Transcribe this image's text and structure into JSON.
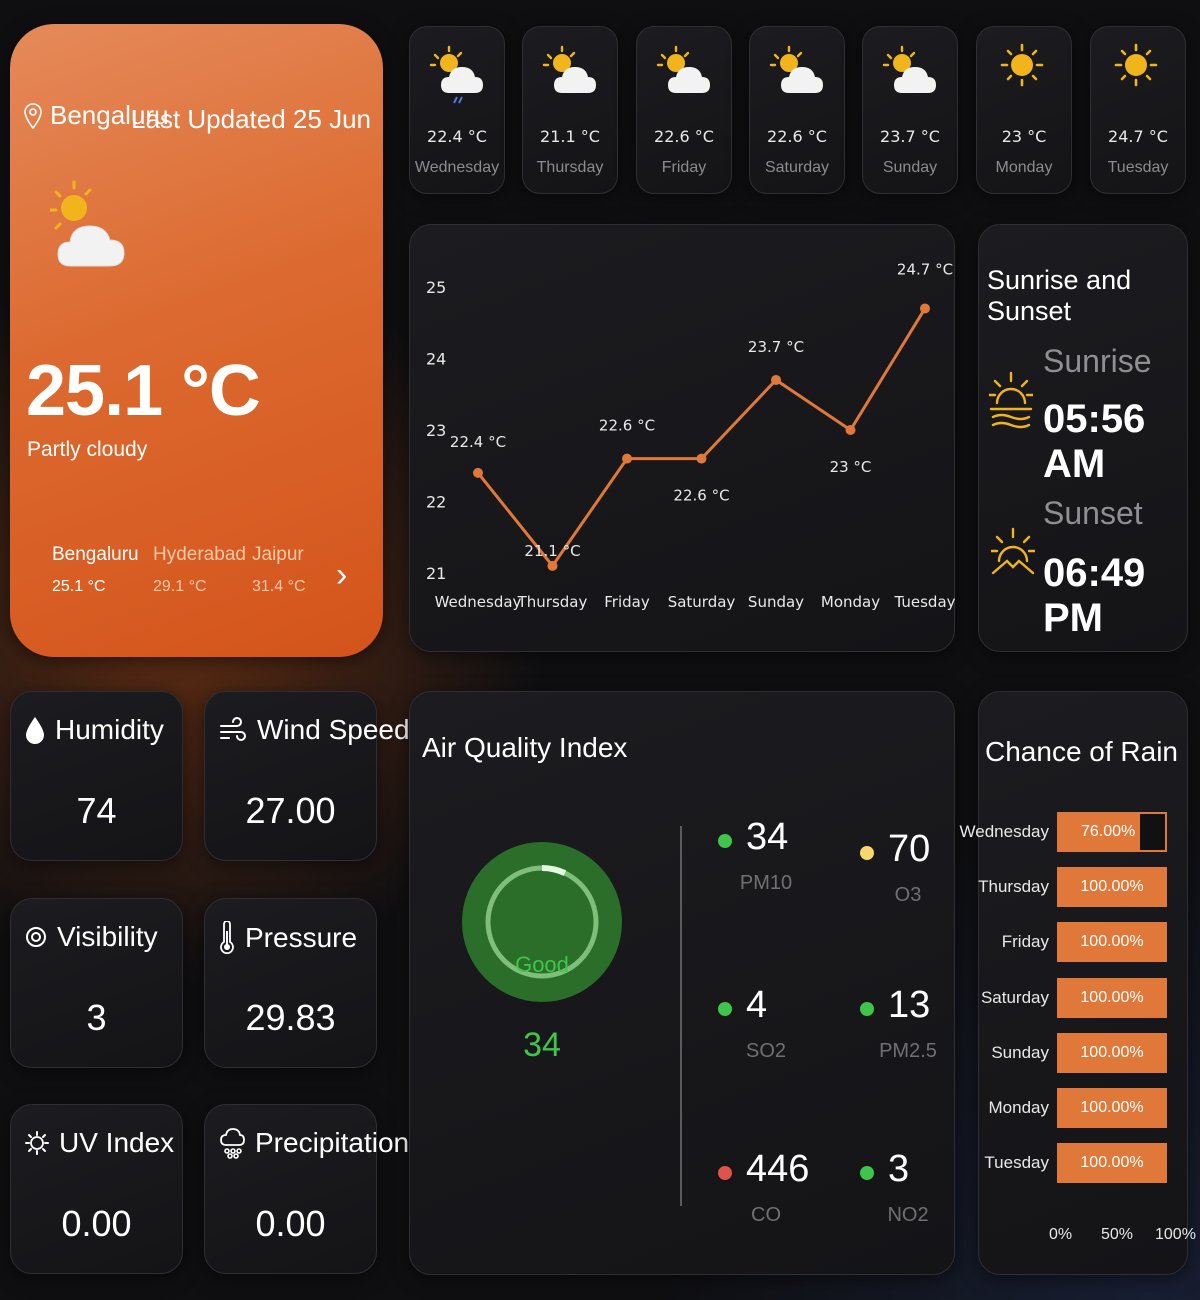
{
  "location": {
    "city": "Bengaluru",
    "last_updated": "Last Updated 25 Jun",
    "temperature": "25.1 °C",
    "condition": "Partly cloudy",
    "icon": "partly-cloudy-icon"
  },
  "cities": [
    {
      "name": "Bengaluru",
      "temp": "25.1 °C"
    },
    {
      "name": "Hyderabad",
      "temp": "29.1 °C"
    },
    {
      "name": "Jaipur",
      "temp": "31.4 °C"
    }
  ],
  "forecast": [
    {
      "day": "Wednesday",
      "temp": "22.4 °C",
      "icon": "rainy-partly-cloudy-icon"
    },
    {
      "day": "Thursday",
      "temp": "21.1 °C",
      "icon": "partly-cloudy-icon"
    },
    {
      "day": "Friday",
      "temp": "22.6 °C",
      "icon": "partly-cloudy-icon"
    },
    {
      "day": "Saturday",
      "temp": "22.6 °C",
      "icon": "partly-cloudy-icon"
    },
    {
      "day": "Sunday",
      "temp": "23.7 °C",
      "icon": "partly-cloudy-icon"
    },
    {
      "day": "Monday",
      "temp": "23 °C",
      "icon": "sunny-icon"
    },
    {
      "day": "Tuesday",
      "temp": "24.7 °C",
      "icon": "sunny-icon"
    }
  ],
  "chart_data": {
    "type": "line",
    "categories": [
      "Wednesday",
      "Thursday",
      "Friday",
      "Saturday",
      "Sunday",
      "Monday",
      "Tuesday"
    ],
    "values": [
      22.4,
      21.1,
      22.6,
      22.6,
      23.7,
      23,
      24.7
    ],
    "data_labels": [
      "22.4 °C",
      "21.1 °C",
      "22.6 °C",
      "22.6 °C",
      "23.7 °C",
      "23 °C",
      "24.7 °C"
    ],
    "y_ticks": [
      "25",
      "24",
      "23",
      "22",
      "21"
    ],
    "ylim": [
      21,
      25
    ],
    "line_color": "#e0783a",
    "grid": false
  },
  "sun": {
    "title": "Sunrise and Sunset",
    "sunrise_label": "Sunrise",
    "sunrise_time": "05:56 AM",
    "sunset_label": "Sunset",
    "sunset_time": "06:49 PM"
  },
  "stats": {
    "humidity": {
      "label": "Humidity",
      "value": "74",
      "icon": "droplet-icon"
    },
    "wind": {
      "label": "Wind Speed",
      "value": "27.00",
      "icon": "wind-icon"
    },
    "visibility": {
      "label": "Visibility",
      "value": "3",
      "icon": "eye-icon"
    },
    "pressure": {
      "label": "Pressure",
      "value": "29.83",
      "icon": "thermometer-icon"
    },
    "uv": {
      "label": "UV Index",
      "value": "0.00",
      "icon": "uv-sun-icon"
    },
    "precipitation": {
      "label": "Precipitation",
      "value": "0.00",
      "icon": "cloud-rain-icon"
    }
  },
  "aqi": {
    "title": "Air Quality Index",
    "status": "Good",
    "value": "34",
    "gauge_fraction": 0.07,
    "pollutants": [
      {
        "name": "PM10",
        "value": "34",
        "color": "#3fc64a"
      },
      {
        "name": "O3",
        "value": "70",
        "color": "#f5d76e"
      },
      {
        "name": "SO2",
        "value": "4",
        "color": "#3fc64a"
      },
      {
        "name": "PM2.5",
        "value": "13",
        "color": "#3fc64a"
      },
      {
        "name": "CO",
        "value": "446",
        "color": "#e0534a"
      },
      {
        "name": "NO2",
        "value": "3",
        "color": "#3fc64a"
      }
    ]
  },
  "rain": {
    "title": "Chance of Rain",
    "rows": [
      {
        "day": "Wednesday",
        "label": "76.00%",
        "fraction": 0.76
      },
      {
        "day": "Thursday",
        "label": "100.00%",
        "fraction": 1.0
      },
      {
        "day": "Friday",
        "label": "100.00%",
        "fraction": 1.0
      },
      {
        "day": "Saturday",
        "label": "100.00%",
        "fraction": 1.0
      },
      {
        "day": "Sunday",
        "label": "100.00%",
        "fraction": 1.0
      },
      {
        "day": "Monday",
        "label": "100.00%",
        "fraction": 1.0
      },
      {
        "day": "Tuesday",
        "label": "100.00%",
        "fraction": 1.0
      }
    ],
    "axis": [
      "0%",
      "50%",
      "100%"
    ]
  },
  "colors": {
    "accent": "#e0783a",
    "good": "#3fc64a",
    "sun_icon": "#f1b41c"
  }
}
